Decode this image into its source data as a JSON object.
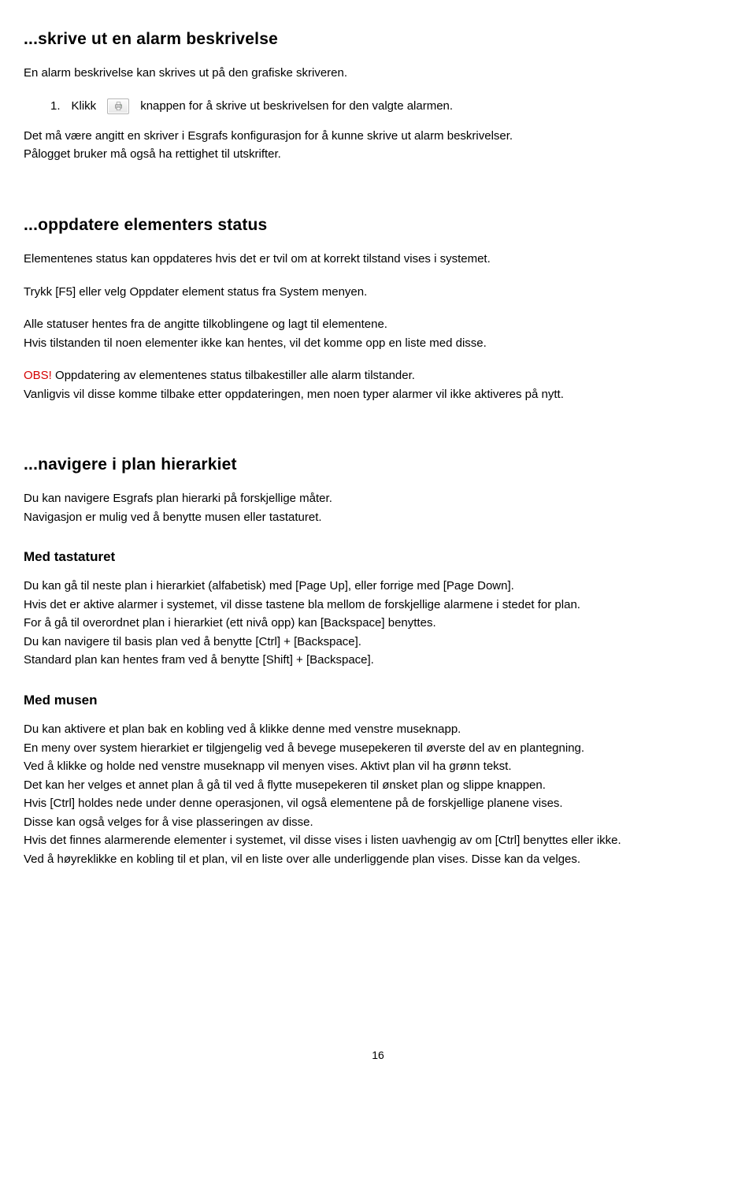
{
  "s1": {
    "title": "...skrive ut en alarm beskrivelse",
    "p1": "En alarm beskrivelse kan skrives ut på den grafiske skriveren.",
    "li_num": "1.",
    "li_a": "Klikk",
    "li_b": "knappen for å skrive ut beskrivelsen for den valgte alarmen.",
    "p2a": "Det må være angitt en skriver i Esgrafs konfigurasjon for å kunne skrive ut alarm beskrivelser.",
    "p2b": "Pålogget bruker må også ha rettighet til utskrifter."
  },
  "s2": {
    "title": "...oppdatere elementers status",
    "p1": "Elementenes status kan oppdateres hvis det er tvil om at korrekt tilstand vises i systemet.",
    "p2": "Trykk [F5] eller velg Oppdater element status fra System menyen.",
    "p3a": "Alle statuser hentes fra de angitte tilkoblingene og lagt til elementene.",
    "p3b": "Hvis tilstanden til noen elementer ikke kan hentes, vil det komme opp en liste med disse.",
    "obs": "OBS!",
    "p4a": " Oppdatering av elementenes status tilbakestiller alle alarm tilstander.",
    "p4b": "Vanligvis vil disse komme tilbake etter oppdateringen, men noen typer alarmer vil ikke aktiveres på nytt."
  },
  "s3": {
    "title": "...navigere i plan hierarkiet",
    "p1a": "Du kan navigere Esgrafs plan hierarki på forskjellige måter.",
    "p1b": "Navigasjon er mulig ved å benytte musen eller tastaturet.",
    "h_kb": "Med tastaturet",
    "kb_l1": "Du kan gå til neste plan i hierarkiet (alfabetisk) med [Page Up], eller forrige med [Page Down].",
    "kb_l2": "Hvis det er aktive alarmer i systemet, vil disse tastene bla mellom de forskjellige alarmene i stedet for plan.",
    "kb_l3": "For å gå til overordnet plan i hierarkiet (ett nivå opp) kan [Backspace] benyttes.",
    "kb_l4": "Du kan navigere til basis plan ved å benytte [Ctrl] + [Backspace].",
    "kb_l5": "Standard plan kan hentes fram ved å benytte [Shift] + [Backspace].",
    "h_mouse": "Med musen",
    "m_l1": "Du kan aktivere et plan bak en kobling ved å klikke denne med venstre museknapp.",
    "m_l2": "En meny over system hierarkiet er tilgjengelig ved å bevege musepekeren til øverste del av en plantegning.",
    "m_l3": "Ved å klikke og holde ned venstre museknapp vil menyen vises. Aktivt plan vil ha grønn tekst.",
    "m_l4": "Det kan her velges et annet plan å gå til ved å flytte musepekeren til ønsket plan og slippe knappen.",
    "m_l5": "Hvis [Ctrl] holdes nede under denne operasjonen, vil også elementene på de forskjellige planene vises.",
    "m_l6": "Disse kan også velges for å vise plasseringen av disse.",
    "m_l7": "Hvis det finnes alarmerende elementer i systemet, vil disse vises i listen uavhengig av om [Ctrl] benyttes eller ikke.",
    "m_l8": "Ved å høyreklikke en kobling til et plan, vil en liste over alle underliggende plan vises. Disse kan da velges."
  },
  "page": "16"
}
